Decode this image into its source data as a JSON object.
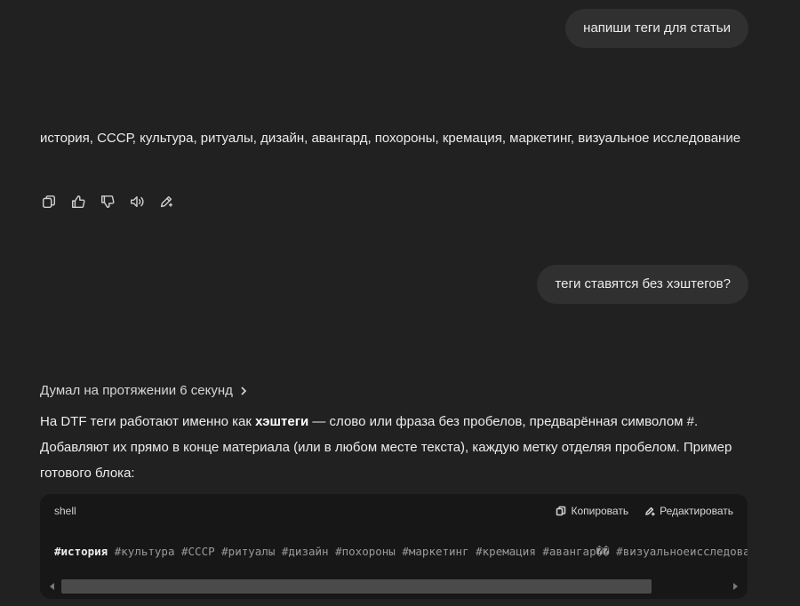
{
  "messages": {
    "user1": "напиши теги для статьи",
    "assistant1": "история, СССР, культура, ритуалы, дизайн, авангард, похороны, кремация, маркетинг, визуальное исследование",
    "user2": "теги ставятся без хэштегов?",
    "thought_label": "Думал на протяжении 6 секунд",
    "assistant2": {
      "part1": "На DTF теги работают именно как ",
      "bold": "хэштеги",
      "part2": " — слово или фраза без пробелов, предварённая символом #. Добавляют их прямо в конце материала (или в любом месте текста), каждую метку отделяя пробелом. Пример готового блока:"
    }
  },
  "actions": {
    "icons": [
      "copy-icon",
      "thumbs-up-icon",
      "thumbs-down-icon",
      "speaker-icon",
      "edit-icon"
    ]
  },
  "code_block": {
    "language": "shell",
    "copy_label": "Копировать",
    "edit_label": "Редактировать",
    "first_tag": "#история",
    "rest": " #культура #СССР #ритуалы #дизайн #похороны #маркетинг #кремация #авангар�� #визуальноеисследование"
  },
  "colors": {
    "background": "#212121",
    "bubble": "#303030",
    "code_background": "#171717",
    "text": "#ececec"
  }
}
